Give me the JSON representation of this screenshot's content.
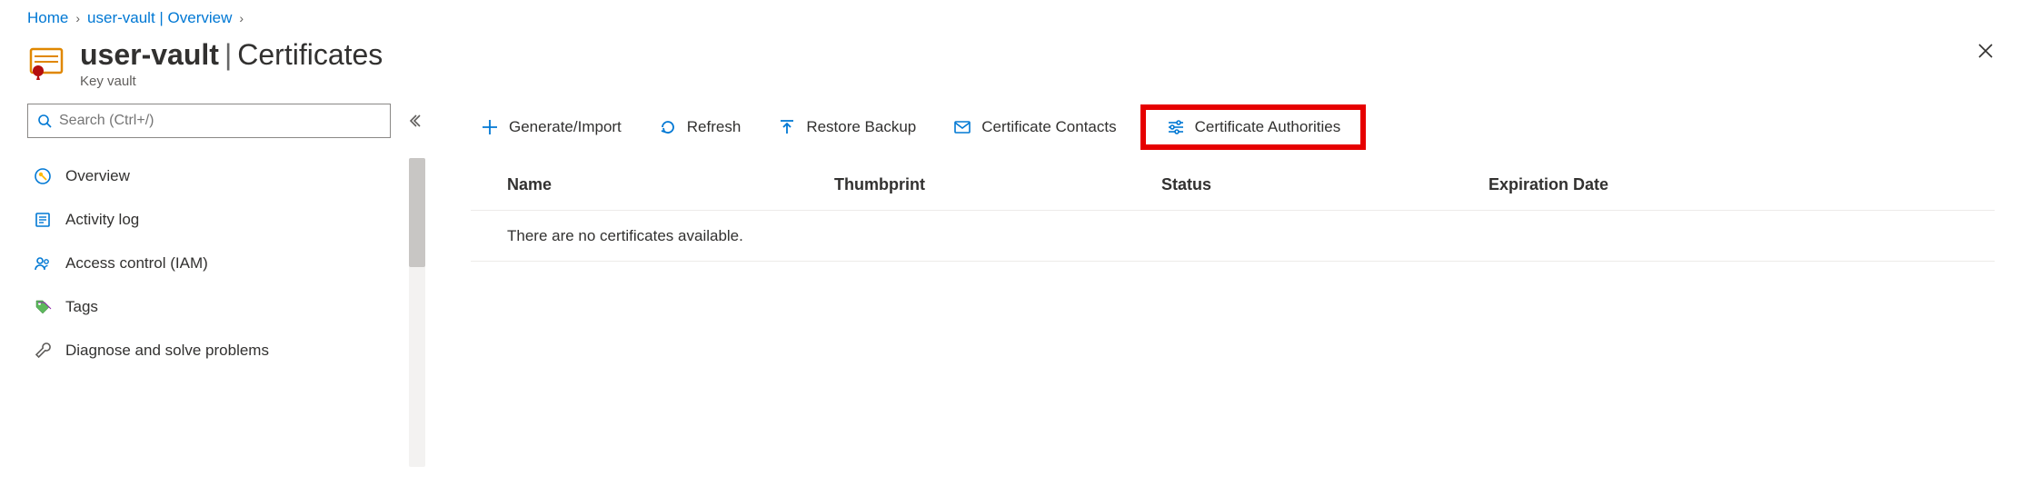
{
  "breadcrumb": {
    "home": "Home",
    "item": "user-vault | Overview"
  },
  "header": {
    "resource": "user-vault",
    "page": "Certificates",
    "subtitle": "Key vault"
  },
  "search": {
    "placeholder": "Search (Ctrl+/)"
  },
  "sidebar": {
    "items": [
      {
        "label": "Overview",
        "icon": "key-circle"
      },
      {
        "label": "Activity log",
        "icon": "activity-log"
      },
      {
        "label": "Access control (IAM)",
        "icon": "people"
      },
      {
        "label": "Tags",
        "icon": "tags"
      },
      {
        "label": "Diagnose and solve problems",
        "icon": "wrench"
      }
    ]
  },
  "toolbar": {
    "generate": "Generate/Import",
    "refresh": "Refresh",
    "restore": "Restore Backup",
    "contacts": "Certificate Contacts",
    "authorities": "Certificate Authorities"
  },
  "table": {
    "columns": [
      "Name",
      "Thumbprint",
      "Status",
      "Expiration Date"
    ],
    "empty_message": "There are no certificates available."
  }
}
